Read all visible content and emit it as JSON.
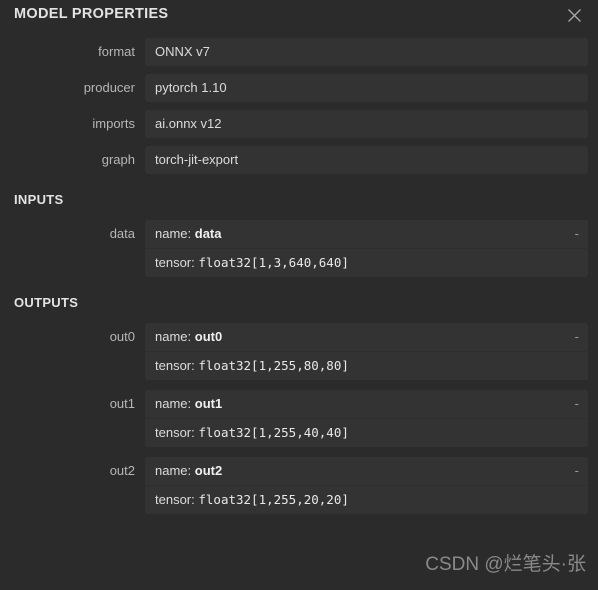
{
  "header": {
    "title": "MODEL PROPERTIES",
    "close_icon": "close-icon"
  },
  "properties": [
    {
      "label": "format",
      "value": "ONNX v7"
    },
    {
      "label": "producer",
      "value": "pytorch 1.10"
    },
    {
      "label": "imports",
      "value": "ai.onnx v12"
    },
    {
      "label": "graph",
      "value": "torch-jit-export"
    }
  ],
  "inputs": {
    "section_title": "INPUTS",
    "items": [
      {
        "label": "data",
        "name_key": "name:",
        "name_value": "data",
        "tensor_key": "tensor:",
        "tensor_value": "float32[1,3,640,640]",
        "dash": "-"
      }
    ]
  },
  "outputs": {
    "section_title": "OUTPUTS",
    "items": [
      {
        "label": "out0",
        "name_key": "name:",
        "name_value": "out0",
        "tensor_key": "tensor:",
        "tensor_value": "float32[1,255,80,80]",
        "dash": "-"
      },
      {
        "label": "out1",
        "name_key": "name:",
        "name_value": "out1",
        "tensor_key": "tensor:",
        "tensor_value": "float32[1,255,40,40]",
        "dash": "-"
      },
      {
        "label": "out2",
        "name_key": "name:",
        "name_value": "out2",
        "tensor_key": "tensor:",
        "tensor_value": "float32[1,255,20,20]",
        "dash": "-"
      }
    ]
  },
  "watermark": {
    "text": "CSDN @烂笔头·张"
  },
  "colors": {
    "background": "#2b2b2b",
    "card": "#333333",
    "label": "#b6b6b6",
    "value": "#dcdcdc",
    "heading": "#e3e3e3"
  }
}
